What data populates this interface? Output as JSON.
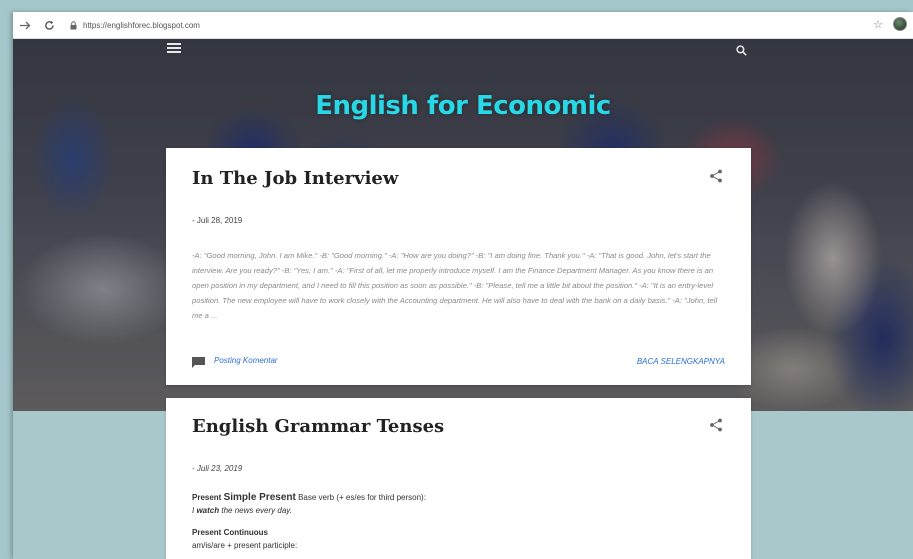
{
  "browser": {
    "url": "https://englishforec.blogspot.com"
  },
  "site": {
    "title": "English for Economic"
  },
  "posts": [
    {
      "title": "In The Job Interview",
      "date": "- Juli 28, 2019",
      "snippet": "-A: \"Good morning, John. I am Mike.\" -B: \"Good morning.\" -A: \"How are you doing?\" -B: \"I am doing fine. Thank you.\" -A: \"That is good. John, let's start the interview. Are you ready?\" -B: \"Yes, I am.\" -A: \"First of all, let me properly introduce myself. I am the Finance Department Manager. As you know there is an open position in my department, and I need to fill this position as soon as possible.\" -B: \"Please, tell me a little bit about the position.\" -A: \"It is an entry-level position. The new employee will have to work closely with the Accounting department. He will also have to deal with the bank on a daily basis.\" -A: \"John, tell me a ...",
      "comment_label": "Posting Komentar",
      "read_more": "BACA SELENGKAPNYA"
    },
    {
      "title": "English Grammar Tenses",
      "date": "- Juli 23, 2019",
      "sections": [
        {
          "heading_prefix": "Present",
          "heading_main": "Simple Present",
          "rule": "Base verb (+ es/es for third person):",
          "example_bold": "watch",
          "example_pre": "I ",
          "example_post": " the news every day."
        },
        {
          "heading": "Present Continuous",
          "rule": "am/is/are + present participle:"
        }
      ]
    }
  ]
}
